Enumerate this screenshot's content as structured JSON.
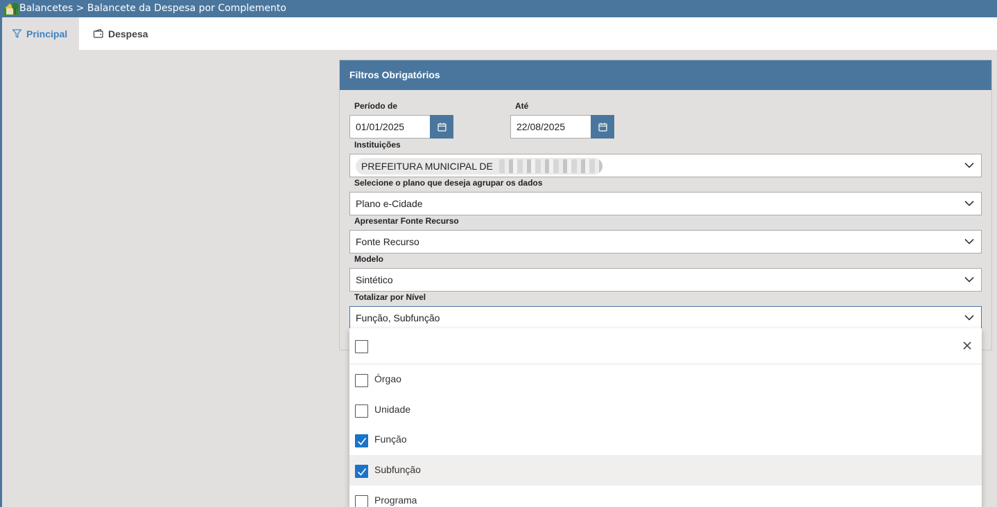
{
  "titlebar": {
    "breadcrumb": "Balancetes > Balancete da Despesa por Complemento",
    "logo_icon": "house-tree-logo"
  },
  "tabs": [
    {
      "label": "Principal",
      "icon": "filter-icon",
      "active": true
    },
    {
      "label": "Despesa",
      "icon": "wallet-icon",
      "active": false
    }
  ],
  "card": {
    "title": "Filtros Obrigatórios"
  },
  "fields": {
    "periodo_label": "Período de",
    "periodo_value": "01/01/2025",
    "ate_label": "Até",
    "ate_value": "22/08/2025",
    "instituicoes_label": "Instituições",
    "instituicoes_value": "PREFEITURA MUNICIPAL DE",
    "plano_label": "Selecione o plano que deseja agrupar os dados",
    "plano_value": "Plano e-Cidade",
    "fonte_label": "Apresentar Fonte Recurso",
    "fonte_value": "Fonte Recurso",
    "modelo_label": "Modelo",
    "modelo_value": "Sintético",
    "nivel_label": "Totalizar por Nível",
    "nivel_value": "Função, Subfunção"
  },
  "dropdown": {
    "options": [
      {
        "label": "Órgao",
        "checked": false
      },
      {
        "label": "Unidade",
        "checked": false
      },
      {
        "label": "Função",
        "checked": true
      },
      {
        "label": "Subfunção",
        "checked": true
      },
      {
        "label": "Programa",
        "checked": false
      }
    ]
  },
  "colors": {
    "header_blue": "#4a769e",
    "check_blue": "#1a73c9",
    "tab_active_text": "#3b82c4",
    "background": "#e2e0df"
  }
}
